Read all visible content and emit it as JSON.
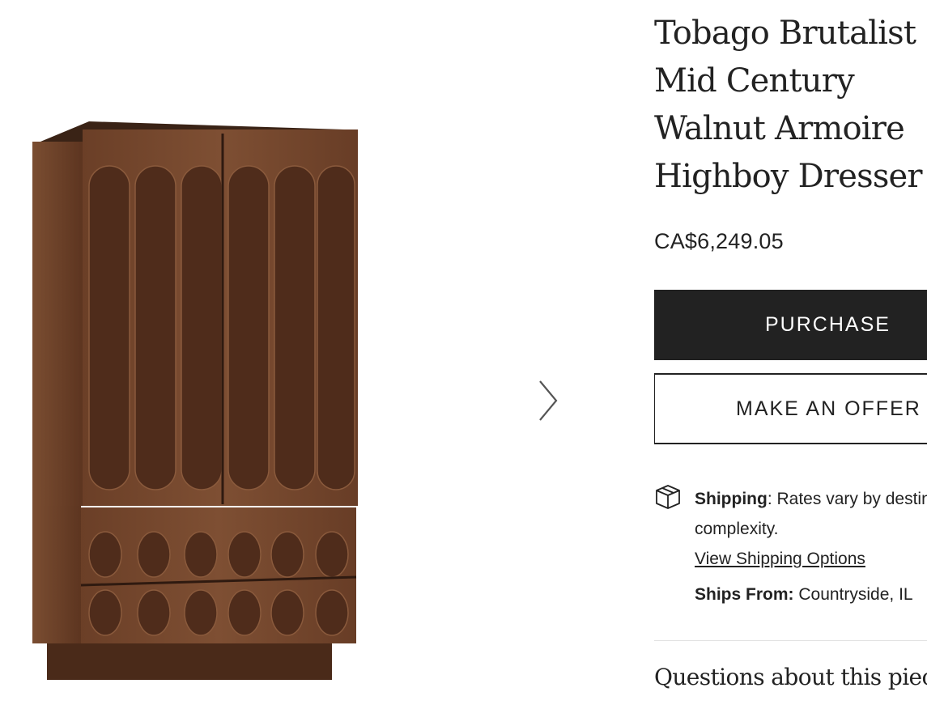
{
  "product": {
    "title_lines": [
      "Tobago Brutalist",
      "Mid Century",
      "Walnut Armoire",
      "Highboy Dresser"
    ],
    "price": "CA$6,249.05"
  },
  "actions": {
    "purchase_label": "PURCHASE",
    "offer_label": "MAKE AN OFFER"
  },
  "shipping": {
    "label": "Shipping",
    "text": ": Rates vary by destination and complexity.",
    "link": "View Shipping Options",
    "from_label": "Ships From:",
    "from_value": " Countryside, IL"
  },
  "questions": "Questions about this piece?",
  "icons": {
    "next": "chevron-right-icon",
    "shipping": "package-icon"
  },
  "colors": {
    "primary": "#222222",
    "wood_dark": "#5a3522",
    "wood_mid": "#7a4b30"
  }
}
